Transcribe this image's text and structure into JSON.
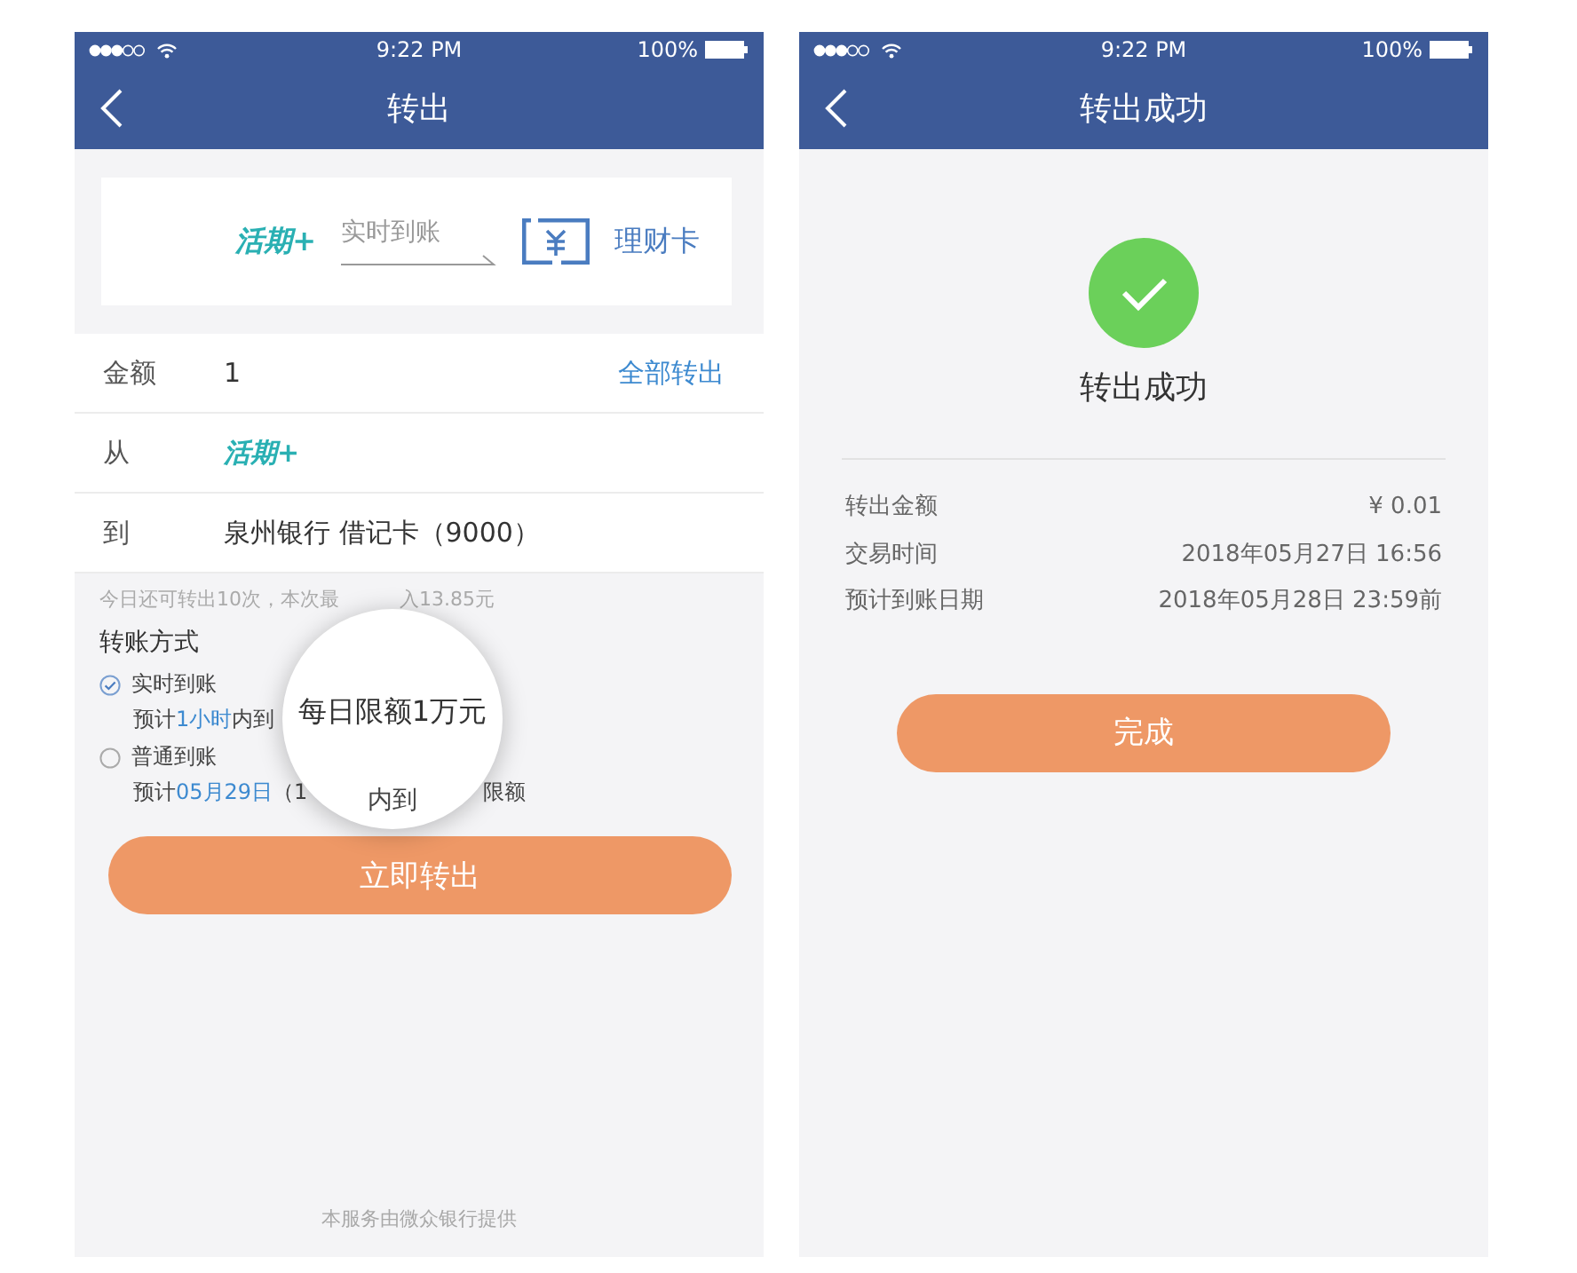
{
  "transfer_screen": {
    "status": {
      "time": "9:22 PM",
      "battery": "100%"
    },
    "title": "转出",
    "transfer_card": {
      "from": "活期+",
      "via": "实时到账",
      "to": "理财卡"
    },
    "fields": [
      {
        "kind": "amount",
        "label": "金额",
        "value": "1",
        "action": "全部转出"
      },
      {
        "kind": "brand",
        "label": "从",
        "value": "活期+"
      },
      {
        "kind": "text",
        "label": "到",
        "value": "泉州银行  借记卡（9000）"
      }
    ],
    "hint_parts": [
      "今日还可转出10次，本次最",
      "入13.85元"
    ],
    "methods_title": "转账方式",
    "methods": [
      {
        "label": "实时到账",
        "selected": true,
        "detail": [
          "预计",
          "1小时",
          "内到"
        ]
      },
      {
        "label": "普通到账",
        "selected": false,
        "detail": [
          "预计",
          "05月29日",
          "（1"
        ],
        "tail": "限额"
      }
    ],
    "magnifier": {
      "text": "每日限额1万元",
      "lower_text": "内到"
    },
    "button": "立即转出",
    "footer": "本服务由微众银行提供"
  },
  "success_screen": {
    "status": {
      "time": "9:22 PM",
      "battery": "100%"
    },
    "title": "转出成功",
    "result": "转出成功",
    "details": [
      {
        "label": "转出金额",
        "value": "¥ 0.01"
      },
      {
        "label": "交易时间",
        "value": "2018年05月27日 16:56"
      },
      {
        "label": "预计到账日期",
        "value": "2018年05月28日 23:59前"
      }
    ],
    "button": "完成"
  }
}
